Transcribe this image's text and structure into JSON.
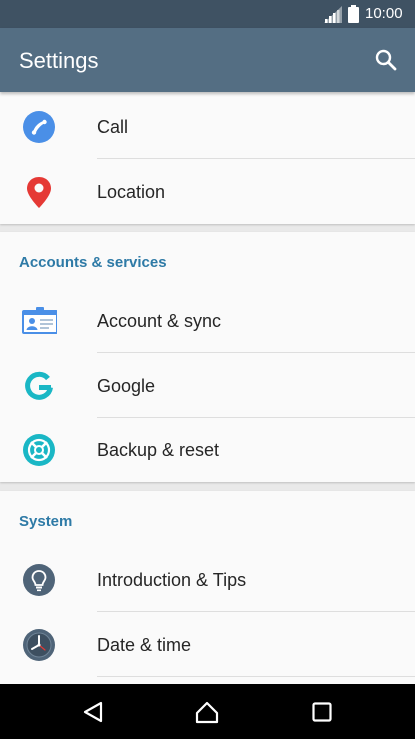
{
  "status_bar": {
    "time": "10:00"
  },
  "app_bar": {
    "title": "Settings"
  },
  "items": {
    "call": "Call",
    "location": "Location",
    "account_sync": "Account & sync",
    "google": "Google",
    "backup_reset": "Backup & reset",
    "intro_tips": "Introduction & Tips",
    "date_time": "Date & time"
  },
  "sections": {
    "accounts": "Accounts & services",
    "system": "System"
  },
  "colors": {
    "status_bar": "#3f5263",
    "app_bar": "#546e83",
    "section_header": "#2e7aa6",
    "accent_blue": "#4a8fe7",
    "location_red": "#e53935",
    "teal": "#1ab7c5"
  }
}
